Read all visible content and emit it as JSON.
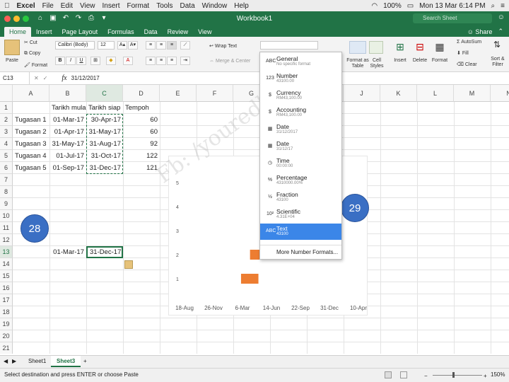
{
  "menubar": {
    "app": "Excel",
    "items": [
      "File",
      "Edit",
      "View",
      "Insert",
      "Format",
      "Tools",
      "Data",
      "Window",
      "Help"
    ],
    "battery": "100%",
    "clock": "Mon 13 Mar  6:14 PM"
  },
  "window": {
    "title": "Workbook1",
    "search_placeholder": "Search Sheet"
  },
  "ribbon": {
    "tabs": [
      "Home",
      "Insert",
      "Page Layout",
      "Formulas",
      "Data",
      "Review",
      "View"
    ],
    "share": "Share",
    "paste": "Paste",
    "cut": "Cut",
    "copy": "Copy",
    "format": "Format",
    "font_name": "Calibri (Body)",
    "font_size": "12",
    "wrap_text": "Wrap Text",
    "merge_center": "Merge & Center",
    "format_as_table": "Format as Table",
    "cell_styles": "Cell Styles",
    "insert": "Insert",
    "delete": "Delete",
    "format_cells": "Format",
    "autosum": "AutoSum",
    "fill": "Fill",
    "clear": "Clear",
    "sort_filter": "Sort & Filter"
  },
  "formula_bar": {
    "name_box": "C13",
    "fx": "fx",
    "value": "31/12/2017"
  },
  "grid": {
    "columns": [
      "A",
      "B",
      "C",
      "D",
      "E",
      "F",
      "G",
      "H",
      "I",
      "J",
      "K",
      "L",
      "M",
      "N"
    ],
    "rows": [
      "1",
      "2",
      "3",
      "4",
      "5",
      "6",
      "7",
      "8",
      "9",
      "10",
      "11",
      "12",
      "13",
      "14",
      "15",
      "16",
      "17",
      "18",
      "19",
      "20",
      "21"
    ],
    "headers": {
      "b": "Tarikh mula",
      "c": "Tarikh siap",
      "d": "Tempoh"
    },
    "data": [
      {
        "task": "Tugasan 1",
        "start": "01-Mar-17",
        "end": "30-Apr-17",
        "dur": "60"
      },
      {
        "task": "Tugasan 2",
        "start": "01-Apr-17",
        "end": "31-May-17",
        "dur": "60"
      },
      {
        "task": "Tugasan 3",
        "start": "31-May-17",
        "end": "31-Aug-17",
        "dur": "92"
      },
      {
        "task": "Tugasan 4",
        "start": "01-Jul-17",
        "end": "31-Oct-17",
        "dur": "122"
      },
      {
        "task": "Tugasan 5",
        "start": "01-Sep-17",
        "end": "31-Dec-17",
        "dur": "121"
      }
    ],
    "row13": {
      "b": "01-Mar-17",
      "c": "31-Dec-17"
    }
  },
  "annotations": {
    "left": "28",
    "right": "29"
  },
  "watermark": "Fb: /youredhouse",
  "chart_data": {
    "type": "bar",
    "y_ticks": [
      "1",
      "2",
      "3",
      "4",
      "5"
    ],
    "x_ticks": [
      "18-Aug",
      "26-Nov",
      "6-Mar",
      "14-Jun",
      "22-Sep",
      "31-Dec",
      "10-Apr"
    ],
    "bars": [
      {
        "y": 1,
        "start": "2017-03-01",
        "days": 60
      },
      {
        "y": 2,
        "start": "2017-04-01",
        "days": 60
      }
    ],
    "color": "#ed7d31"
  },
  "number_format_menu": {
    "items": [
      {
        "icon": "ABC",
        "name": "General",
        "sample": "No specific format"
      },
      {
        "icon": "123",
        "name": "Number",
        "sample": "43100.00"
      },
      {
        "icon": "$",
        "name": "Currency",
        "sample": "RM43,100.00"
      },
      {
        "icon": "$",
        "name": "Accounting",
        "sample": "RM43,100.00"
      },
      {
        "icon": "▦",
        "name": "Date",
        "sample": "31/12/2017"
      },
      {
        "icon": "▦",
        "name": "Date",
        "sample": "31/12/17"
      },
      {
        "icon": "◷",
        "name": "Time",
        "sample": "00:00:00"
      },
      {
        "icon": "%",
        "name": "Percentage",
        "sample": "4310000.00%"
      },
      {
        "icon": "½",
        "name": "Fraction",
        "sample": "43100"
      },
      {
        "icon": "10²",
        "name": "Scientific",
        "sample": "4.31E+04"
      },
      {
        "icon": "ABC",
        "name": "Text",
        "sample": "43100"
      }
    ],
    "selected": 10,
    "more": "More Number Formats..."
  },
  "sheets": {
    "tabs": [
      "Sheet1",
      "Sheet3"
    ],
    "active": 1,
    "add": "+"
  },
  "status": {
    "text": "Select destination and press ENTER or choose Paste",
    "zoom": "150%"
  }
}
